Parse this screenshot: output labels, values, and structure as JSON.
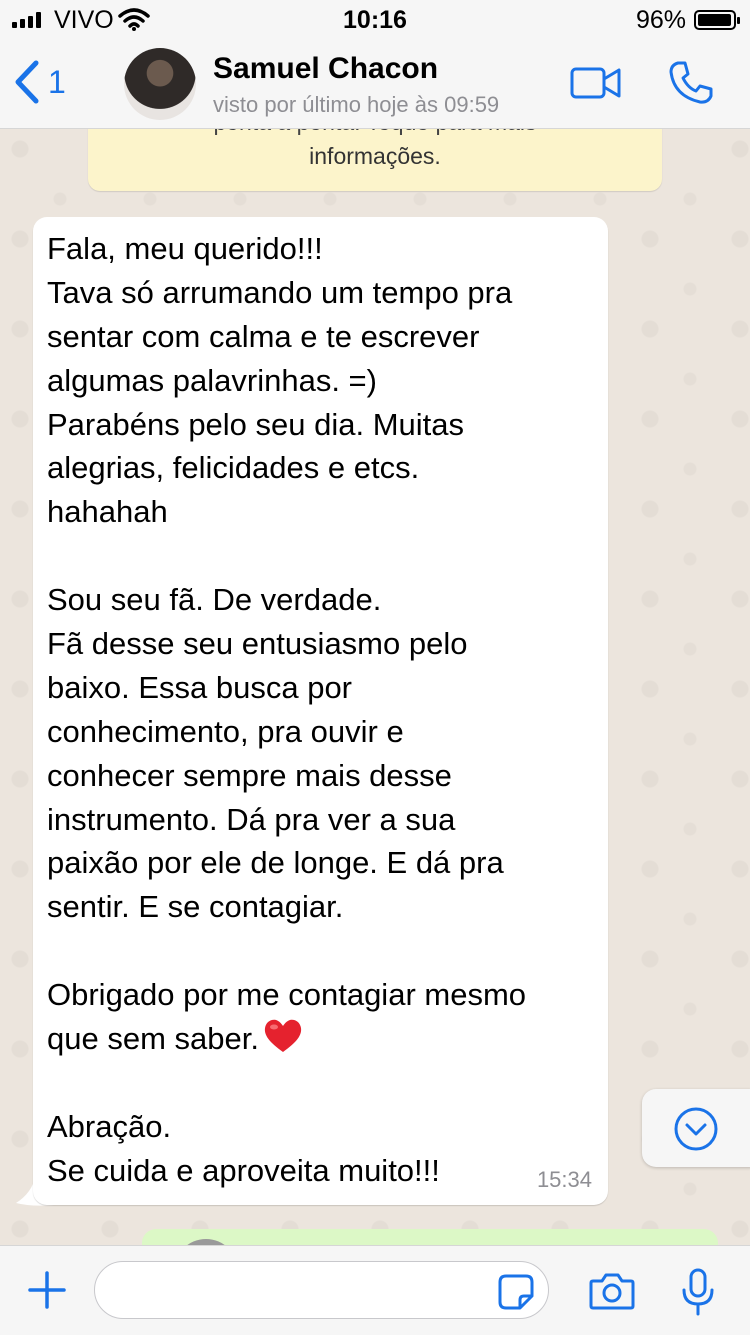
{
  "status_bar": {
    "carrier": "VIVO",
    "time": "10:16",
    "battery_percent": "96%",
    "battery_level": 0.96
  },
  "header": {
    "back_count": "1",
    "contact_name": "Samuel Chacon",
    "last_seen": "visto por último hoje às 09:59",
    "accent_color": "#1a73e8"
  },
  "chat": {
    "encryption_notice": {
      "line1": "ponta a ponta. Toque para mais",
      "line2": "informações."
    },
    "message": {
      "lines": [
        "Fala, meu querido!!!",
        "Tava só arrumando um tempo pra",
        "sentar com calma e te escrever",
        "algumas palavrinhas. =)",
        "Parabéns pelo seu dia. Muitas",
        "alegrias, felicidades e etcs.",
        "hahahah",
        "",
        "Sou seu fã. De verdade.",
        "Fã desse seu entusiasmo pelo",
        "baixo. Essa busca por",
        "conhecimento, pra ouvir e",
        "conhecer sempre mais desse",
        "instrumento. Dá pra ver a sua",
        "paixão por ele de longe. E dá pra",
        "sentir. E se contagiar.",
        "",
        "Obrigado por me contagiar mesmo",
        "que sem saber.",
        "",
        "Abração.",
        "Se cuida e aproveita muito!!!"
      ],
      "emoji": "heart-emoji",
      "time": "15:34"
    }
  },
  "input_bar": {
    "placeholder": "",
    "icons": [
      "plus-icon",
      "sticker-icon",
      "camera-icon",
      "microphone-icon"
    ]
  }
}
